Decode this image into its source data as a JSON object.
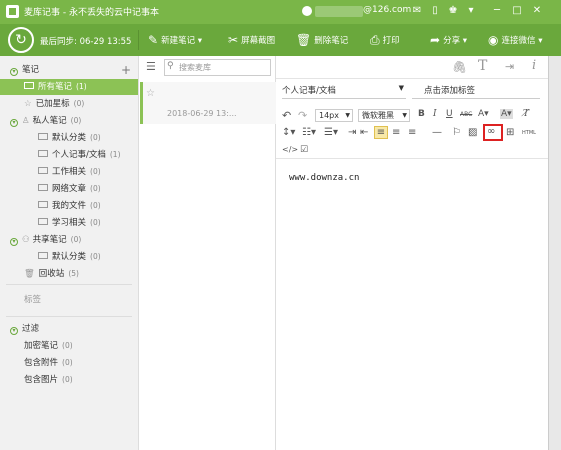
{
  "window": {
    "title": "麦库记事 - 永不丢失的云中记事本",
    "account": "@126.com"
  },
  "toolbar": {
    "sync_label": "最后同步: 06-29 13:55",
    "new_note": "新建笔记",
    "screenshot": "屏幕截图",
    "delete_note": "删除笔记",
    "print": "打印",
    "share": "分享",
    "wechat": "连接微信"
  },
  "sidebar": {
    "notes_header": "笔记",
    "all_notes": {
      "label": "所有笔记",
      "count": "(1)"
    },
    "starred": {
      "label": "已加星标",
      "count": "(0)"
    },
    "private_header": {
      "label": "私人笔记",
      "count": "(0)"
    },
    "private_items": [
      {
        "label": "默认分类",
        "count": "(0)"
      },
      {
        "label": "个人记事/文档",
        "count": "(1)"
      },
      {
        "label": "工作相关",
        "count": "(0)"
      },
      {
        "label": "网络文章",
        "count": "(0)"
      },
      {
        "label": "我的文件",
        "count": "(0)"
      },
      {
        "label": "学习相关",
        "count": "(0)"
      }
    ],
    "shared_header": {
      "label": "共享笔记",
      "count": "(0)"
    },
    "shared_items": [
      {
        "label": "默认分类",
        "count": "(0)"
      }
    ],
    "trash": {
      "label": "回收站",
      "count": "(5)"
    },
    "tags_header": "标签",
    "filter_header": "过滤",
    "filters": [
      {
        "label": "加密笔记",
        "count": "(0)"
      },
      {
        "label": "包含附件",
        "count": "(0)"
      },
      {
        "label": "包含图片",
        "count": "(0)"
      }
    ]
  },
  "list": {
    "search_placeholder": "搜索麦库",
    "note_date": "2018-06-29 13:..."
  },
  "editor": {
    "category": "个人记事/文档",
    "tag_placeholder": "点击添加标签",
    "font_size": "14px",
    "font_family": "微软雅黑",
    "content": "www.downza.cn"
  },
  "colors": {
    "brand_green": "#7ab648",
    "toolbar_green": "#6aa83c",
    "selected_green": "#8cc255",
    "highlight_red": "#d22"
  }
}
